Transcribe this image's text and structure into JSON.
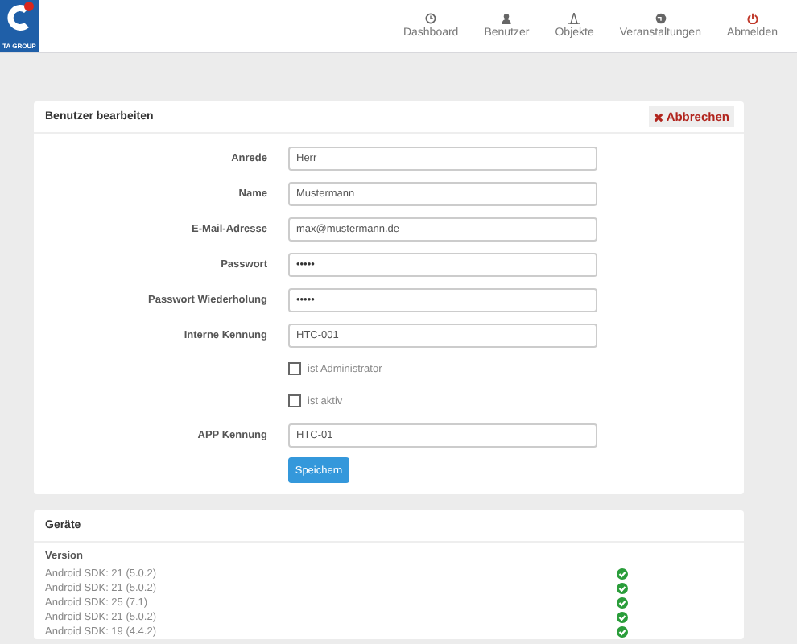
{
  "logo": {
    "text": "TA GROUP"
  },
  "nav": [
    {
      "label": "Dashboard",
      "danger": false
    },
    {
      "label": "Benutzer",
      "danger": false
    },
    {
      "label": "Objekte",
      "danger": false
    },
    {
      "label": "Veranstaltungen",
      "danger": false
    },
    {
      "label": "Abmelden",
      "danger": true
    }
  ],
  "edit_card": {
    "title": "Benutzer bearbeiten",
    "cancel_button": "Abbrechen",
    "fields": [
      {
        "kind": "text",
        "label": "Anrede",
        "value": "Herr"
      },
      {
        "kind": "text",
        "label": "Name",
        "value": "Mustermann"
      },
      {
        "kind": "text",
        "label": "E-Mail-Adresse",
        "value": "max@mustermann.de"
      },
      {
        "kind": "password",
        "label": "Passwort",
        "value": "•••••"
      },
      {
        "kind": "password",
        "label": "Passwort Wiederholung",
        "value": "•••••"
      },
      {
        "kind": "text",
        "label": "Interne Kennung",
        "value": "HTC-001"
      },
      {
        "kind": "checkbox",
        "label": "ist Administrator",
        "checked": false
      },
      {
        "kind": "checkbox",
        "label": "ist aktiv",
        "checked": false
      },
      {
        "kind": "text",
        "label": "APP Kennung",
        "value": "HTC-01"
      }
    ],
    "save_button": "Speichern"
  },
  "devices_card": {
    "title": "Geräte",
    "column_header": "Version",
    "rows": [
      {
        "version": "Android SDK: 21 (5.0.2)",
        "ok": true
      },
      {
        "version": "Android SDK: 21 (5.0.2)",
        "ok": true
      },
      {
        "version": "Android SDK: 25 (7.1)",
        "ok": true
      },
      {
        "version": "Android SDK: 21 (5.0.2)",
        "ok": true
      },
      {
        "version": "Android SDK: 19 (4.4.2)",
        "ok": true
      }
    ]
  }
}
